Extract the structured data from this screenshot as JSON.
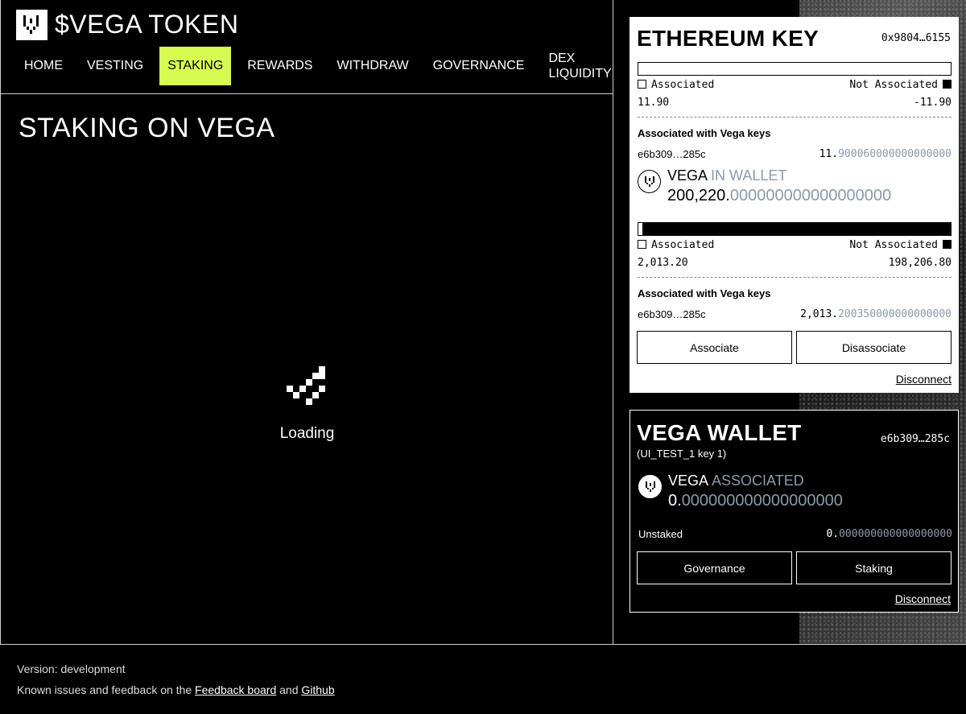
{
  "app": {
    "title": "$VEGA TOKEN"
  },
  "nav": [
    {
      "label": "HOME",
      "active": false
    },
    {
      "label": "VESTING",
      "active": false
    },
    {
      "label": "STAKING",
      "active": true
    },
    {
      "label": "REWARDS",
      "active": false
    },
    {
      "label": "WITHDRAW",
      "active": false
    },
    {
      "label": "GOVERNANCE",
      "active": false
    },
    {
      "label": "DEX LIQUIDITY",
      "active": false
    }
  ],
  "main": {
    "title": "STAKING ON VEGA",
    "loading_text": "Loading"
  },
  "eth_card": {
    "title": "ETHEREUM KEY",
    "address": "0x9804…6155",
    "section1": {
      "associated_label": "Associated",
      "not_associated_label": "Not Associated",
      "associated_value": "11.90",
      "not_associated_value": "-11.90",
      "assoc_header": "Associated with Vega keys",
      "key": "e6b309…285c",
      "key_value_int": "11.",
      "key_value_dec": "900060000000000000"
    },
    "token": {
      "name": "VEGA",
      "label": "IN WALLET",
      "balance_int": "200,220.",
      "balance_dec": "000000000000000000"
    },
    "section2": {
      "associated_label": "Associated",
      "not_associated_label": "Not Associated",
      "associated_value": "2,013.20",
      "not_associated_value": "198,206.80",
      "assoc_header": "Associated with Vega keys",
      "key": "e6b309…285c",
      "key_value_int": "2,013.",
      "key_value_dec": "200350000000000000"
    },
    "associate_label": "Associate",
    "disassociate_label": "Disassociate",
    "disconnect_label": "Disconnect"
  },
  "vega_card": {
    "title": "VEGA WALLET",
    "address": "e6b309…285c",
    "subtitle": "(UI_TEST_1 key 1)",
    "token": {
      "name": "VEGA",
      "label": "ASSOCIATED",
      "balance_int": "0.",
      "balance_dec": "000000000000000000"
    },
    "unstaked_label": "Unstaked",
    "unstaked_int": "0.",
    "unstaked_dec": "000000000000000000",
    "governance_label": "Governance",
    "staking_label": "Staking",
    "disconnect_label": "Disconnect"
  },
  "footer": {
    "version": "Version: development",
    "feedback_prefix": "Known issues and feedback on the",
    "feedback_link": "Feedback board",
    "and": "and",
    "github_link": "Github"
  },
  "colors": {
    "accent": "#d7fb50",
    "muted": "#8a9aa8"
  }
}
